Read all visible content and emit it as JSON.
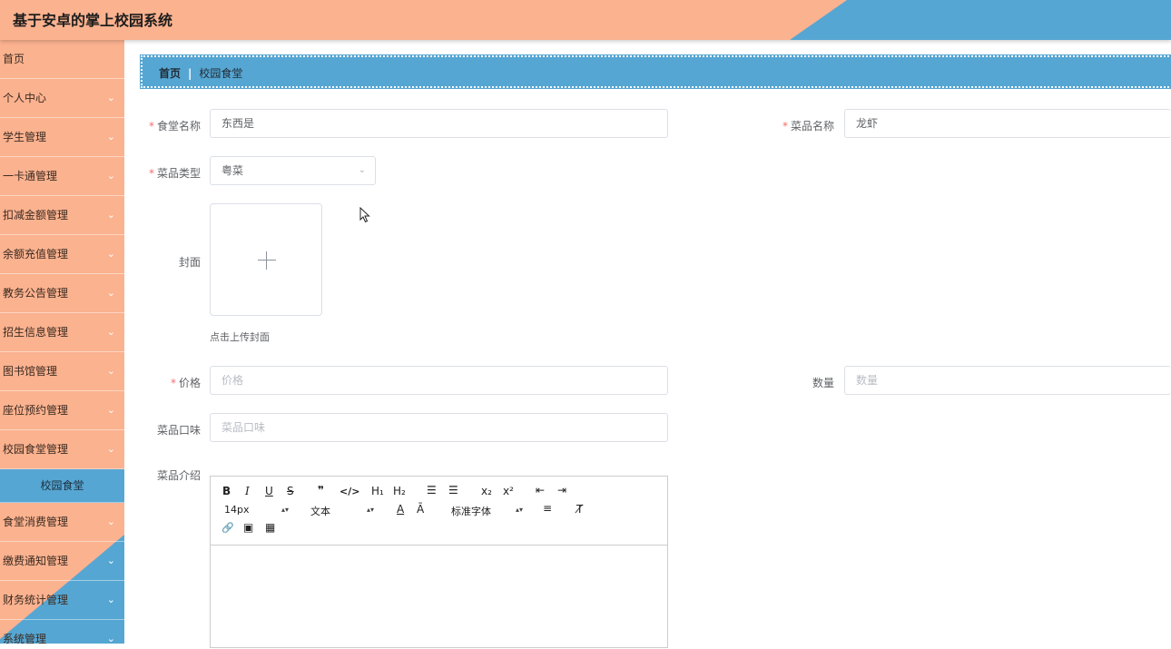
{
  "app": {
    "title": "基于安卓的掌上校园系统"
  },
  "sidebar": {
    "items": [
      {
        "label": "首页",
        "chevron": false
      },
      {
        "label": "个人中心",
        "chevron": true
      },
      {
        "label": "学生管理",
        "chevron": true
      },
      {
        "label": "一卡通管理",
        "chevron": true
      },
      {
        "label": "扣减金额管理",
        "chevron": true
      },
      {
        "label": "余额充值管理",
        "chevron": true
      },
      {
        "label": "教务公告管理",
        "chevron": true
      },
      {
        "label": "招生信息管理",
        "chevron": true
      },
      {
        "label": "图书馆管理",
        "chevron": true
      },
      {
        "label": "座位预约管理",
        "chevron": true
      },
      {
        "label": "校园食堂管理",
        "chevron": true
      },
      {
        "label": "校园食堂",
        "sub": true
      },
      {
        "label": "食堂消费管理",
        "chevron": true
      },
      {
        "label": "缴费通知管理",
        "chevron": true
      },
      {
        "label": "财务统计管理",
        "chevron": true
      },
      {
        "label": "系统管理",
        "chevron": true
      }
    ],
    "chevron_icon": "chevron-down-icon"
  },
  "breadcrumb": {
    "home": "首页",
    "separator": "|",
    "current": "校园食堂"
  },
  "form": {
    "canteen_name": {
      "label": "食堂名称",
      "required": true,
      "value": "东西是"
    },
    "dish_name": {
      "label": "菜品名称",
      "required": true,
      "value": "龙虾"
    },
    "dish_type": {
      "label": "菜品类型",
      "required": true,
      "value": "粤菜"
    },
    "cover": {
      "label": "封面",
      "tip": "点击上传封面",
      "icon": "plus-icon"
    },
    "price": {
      "label": "价格",
      "required": true,
      "placeholder": "价格"
    },
    "quantity": {
      "label": "数量",
      "placeholder": "数量"
    },
    "taste": {
      "label": "菜品口味",
      "placeholder": "菜品口味"
    },
    "intro": {
      "label": "菜品介绍"
    }
  },
  "editor": {
    "font_size": "14px",
    "header": "文本",
    "font_family": "标准字体",
    "buttons": {
      "bold": "B",
      "italic": "I",
      "underline": "U",
      "strike": "S",
      "blockquote": "❞",
      "code": "</>",
      "h1": "H₁",
      "h2": "H₂",
      "ordered_list": "☰",
      "bullet_list": "☰",
      "subscript": "x₂",
      "superscript": "x²",
      "outdent": "⇤",
      "indent": "⇥",
      "color": "A",
      "background": "Ā",
      "align": "≡",
      "clean": "T̸",
      "link": "🔗",
      "image": "▣",
      "video": "▦"
    }
  },
  "colors": {
    "header_orange": "#fbb28f",
    "accent_blue": "#56a6d3",
    "required": "#f56c6c"
  }
}
